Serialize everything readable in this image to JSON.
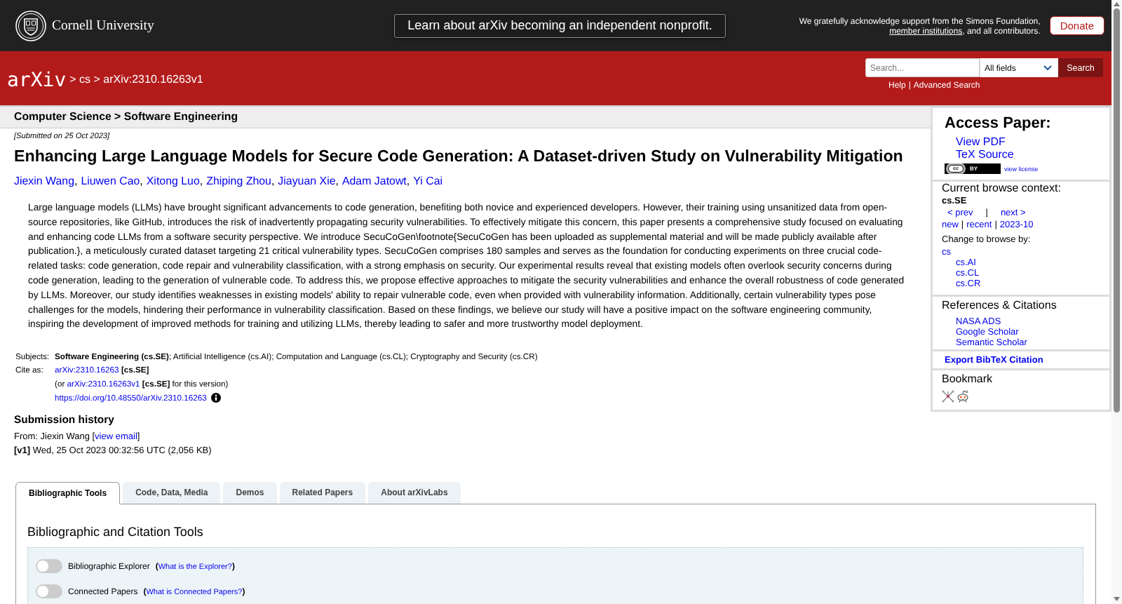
{
  "top_bar": {
    "institution": "Cornell University",
    "banner": "Learn about arXiv becoming an independent nonprofit.",
    "support": {
      "before": "We gratefully acknowledge support from the Simons Foundation, ",
      "link": "member institutions",
      "after": ", and all contributors."
    },
    "donate": "Donate"
  },
  "header": {
    "logo": "arXiv",
    "breadcrumb": "> cs > arXiv:2310.16263v1",
    "search": {
      "placeholder": "Search...",
      "field": "All fields",
      "button": "Search"
    },
    "links": [
      {
        "label": "Help",
        "separator": "|"
      },
      {
        "label": "Advanced Search"
      }
    ]
  },
  "paper": {
    "category": "Computer Science > Software Engineering",
    "submitted": "[Submitted on 25 Oct 2023]",
    "title": "Enhancing Large Language Models for Secure Code Generation: A Dataset-driven Study on Vulnerability Mitigation",
    "authors": [
      {
        "name": "Jiexin Wang",
        "separator": ","
      },
      {
        "name": "Liuwen Cao",
        "separator": ","
      },
      {
        "name": "Xitong Luo",
        "separator": ","
      },
      {
        "name": "Zhiping Zhou",
        "separator": ","
      },
      {
        "name": "Jiayuan Xie",
        "separator": ","
      },
      {
        "name": "Adam Jatowt",
        "separator": ","
      },
      {
        "name": "Yi Cai"
      }
    ],
    "abstract": "Large language models (LLMs) have brought significant advancements to code generation, benefiting both novice and experienced developers. However, their training using unsanitized data from open-source repositories, like GitHub, introduces the risk of inadvertently propagating security vulnerabilities. To effectively mitigate this concern, this paper presents a comprehensive study focused on evaluating and enhancing code LLMs from a software security perspective. We introduce SecuCoGen\\footnote{SecuCoGen has been uploaded as supplemental material and will be made publicly available after publication.}, a meticulously curated dataset targeting 21 critical vulnerability types. SecuCoGen comprises 180 samples and serves as the foundation for conducting experiments on three crucial code-related tasks: code generation, code repair and vulnerability classification, with a strong emphasis on security. Our experimental results reveal that existing models often overlook security concerns during code generation, leading to the generation of vulnerable code. To address this, we propose effective approaches to mitigate the security vulnerabilities and enhance the overall robustness of code generated by LLMs. Moreover, our study identifies weaknesses in existing models' ability to repair vulnerable code, even when provided with vulnerability information. Additionally, certain vulnerability types pose challenges for the models, hindering their performance in vulnerability classification. Based on these findings, we believe our study will have a positive impact on the software engineering community, inspiring the development of improved methods for training and utilizing LLMs, thereby leading to safer and more trustworthy model deployment."
  },
  "metadata": {
    "subjects": {
      "label": "Subjects:",
      "value": "**Software Engineering (cs.SE)**; Artificial Intelligence (cs.AI); Computation and Language (cs.CL); Cryptography and Security (cs.CR)"
    },
    "cite": {
      "label": "Cite as:",
      "rows": [
        {
          "kind": "arxiv",
          "link": "arXiv:2310.16263",
          "tag": "[cs.SE]"
        },
        {
          "kind": "arxiv",
          "before": "(or ",
          "link": "arXiv:2310.16263v1",
          "tag": "[cs.SE]",
          "after": " for this version)"
        },
        {
          "kind": "doi",
          "link": "https://doi.org/10.48550/arXiv.2310.16263"
        }
      ]
    }
  },
  "submission": {
    "heading": "Submission history",
    "from": {
      "before": "From: Jiexin Wang [",
      "link": "view email",
      "after": "]"
    },
    "versions": [
      {
        "version": "[v1]",
        "details": "Wed, 25 Oct 2023 00:32:56 UTC (2,056 KB)"
      }
    ]
  },
  "sidebar": {
    "access": {
      "heading": "Access Paper:",
      "links": [
        "View PDF",
        "TeX Source"
      ],
      "license": {
        "mark": "cc",
        "label": "BY",
        "link": "view license"
      }
    },
    "browse": {
      "heading": "Current browse context:",
      "category": "cs.SE",
      "prev": "< prev",
      "separator": "|",
      "next": "next >",
      "lists": [
        {
          "label": "new",
          "separator": "|"
        },
        {
          "label": "recent",
          "separator": "|"
        },
        {
          "label": "2023-10"
        }
      ],
      "change_label": "Change to browse by:",
      "tree": [
        {
          "label": "cs",
          "children": [
            {
              "label": "cs.AI"
            },
            {
              "label": "cs.CL"
            },
            {
              "label": "cs.CR"
            }
          ]
        }
      ]
    },
    "references": {
      "heading": "References & Citations",
      "links": [
        "NASA ADS",
        "Google Scholar",
        "Semantic Scholar"
      ]
    },
    "export": "Export BibTeX Citation",
    "bookmark": {
      "heading": "Bookmark"
    }
  },
  "labs": {
    "tabs": [
      {
        "label": "Bibliographic Tools",
        "selected": true
      },
      {
        "label": "Code, Data, Media",
        "selected": false
      },
      {
        "label": "Demos",
        "selected": false
      },
      {
        "label": "Related Papers",
        "selected": false
      },
      {
        "label": "About arXivLabs",
        "selected": false
      }
    ],
    "panel": {
      "heading": "Bibliographic and Citation Tools",
      "tools": [
        {
          "label": "Bibliographic Explorer",
          "help": {
            "open": "(",
            "link": "What is the Explorer?",
            "close": ")"
          },
          "on": false
        },
        {
          "label": "Connected Papers",
          "help": {
            "open": "(",
            "link": "What is Connected Papers?",
            "close": ")"
          },
          "on": false
        }
      ]
    }
  }
}
